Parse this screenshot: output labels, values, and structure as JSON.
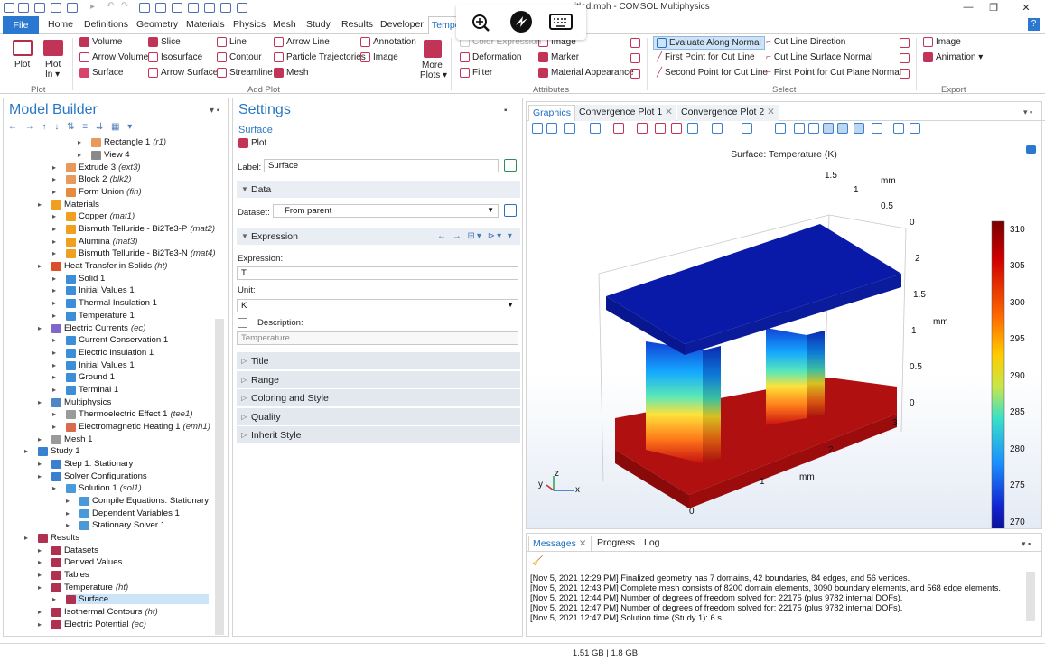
{
  "window": {
    "title": "Untitled.mph - COMSOL Multiphysics",
    "title_visible": "itled.mph - COMSOL Multiphysics",
    "help": "?"
  },
  "menu": {
    "file": "File",
    "tabs": [
      "Home",
      "Definitions",
      "Geometry",
      "Materials",
      "Physics",
      "Mesh",
      "Study",
      "Results",
      "Developer"
    ],
    "active": "Tempe"
  },
  "ribbon": {
    "plot": {
      "plot": "Plot",
      "plot_in": "Plot",
      "plot_in2": "In ▾",
      "group": "Plot"
    },
    "add_plot": {
      "col1": [
        "Volume",
        "Arrow Volume",
        "Surface"
      ],
      "col2": [
        "Slice",
        "Isosurface",
        "Arrow Surface"
      ],
      "col3": [
        "Line",
        "Contour",
        "Streamline"
      ],
      "col4": [
        "Arrow Line",
        "Particle Trajectories",
        "Mesh"
      ],
      "col5": [
        "Annotation",
        "Image"
      ],
      "more": "More",
      "more2": "Plots ▾",
      "group": "Add Plot"
    },
    "attributes": {
      "items": [
        "Color Expression",
        "Deformation",
        "Filter"
      ],
      "items2": [
        "Image",
        "Marker",
        "Material Appearance"
      ],
      "group": "Attributes"
    },
    "select": {
      "col1": [
        "Evaluate Along Normal",
        "First Point for Cut Line",
        "Second Point for Cut Line"
      ],
      "col2": [
        "Cut Line Direction",
        "Cut Line Surface Normal",
        "First Point for Cut Plane Normal"
      ],
      "group": "Select"
    },
    "export": {
      "image": "Image",
      "animation": "Animation ▾",
      "group": "Export"
    }
  },
  "model_builder": {
    "title": "Model Builder",
    "tree": [
      {
        "label": "Rectangle 1",
        "tag": "(r1)",
        "x": 97,
        "y": 158,
        "color": "#e89a5c"
      },
      {
        "label": "View 4",
        "tag": "",
        "x": 97,
        "y": 172,
        "color": "#8a8a8a"
      },
      {
        "label": "Extrude 3",
        "tag": "(ext3)",
        "x": 69,
        "y": 186,
        "color": "#e89a5c"
      },
      {
        "label": "Block 2",
        "tag": "(blk2)",
        "x": 69,
        "y": 199,
        "color": "#e89a5c"
      },
      {
        "label": "Form Union",
        "tag": "(fin)",
        "x": 69,
        "y": 213,
        "color": "#e88a3c"
      },
      {
        "label": "Materials",
        "tag": "",
        "x": 53,
        "y": 227,
        "color": "#f0a020"
      },
      {
        "label": "Copper",
        "tag": "(mat1)",
        "x": 69,
        "y": 240,
        "color": "#f0a020"
      },
      {
        "label": "Bismuth Telluride - Bi2Te3-P",
        "tag": "(mat2)",
        "x": 69,
        "y": 254,
        "color": "#f0a020"
      },
      {
        "label": "Alumina",
        "tag": "(mat3)",
        "x": 69,
        "y": 268,
        "color": "#f0a020"
      },
      {
        "label": "Bismuth Telluride - Bi2Te3-N",
        "tag": "(mat4)",
        "x": 69,
        "y": 281,
        "color": "#f0a020"
      },
      {
        "label": "Heat Transfer in Solids",
        "tag": "(ht)",
        "x": 53,
        "y": 295,
        "color": "#d9502a"
      },
      {
        "label": "Solid 1",
        "tag": "",
        "x": 69,
        "y": 309,
        "color": "#3d8ed8"
      },
      {
        "label": "Initial Values 1",
        "tag": "",
        "x": 69,
        "y": 322,
        "color": "#3d8ed8"
      },
      {
        "label": "Thermal Insulation 1",
        "tag": "",
        "x": 69,
        "y": 336,
        "color": "#3d8ed8"
      },
      {
        "label": "Temperature 1",
        "tag": "",
        "x": 69,
        "y": 350,
        "color": "#3d8ed8"
      },
      {
        "label": "Electric Currents",
        "tag": "(ec)",
        "x": 53,
        "y": 364,
        "color": "#7f66c9"
      },
      {
        "label": "Current Conservation 1",
        "tag": "",
        "x": 69,
        "y": 377,
        "color": "#3d8ed8"
      },
      {
        "label": "Electric Insulation 1",
        "tag": "",
        "x": 69,
        "y": 391,
        "color": "#3d8ed8"
      },
      {
        "label": "Initial Values 1",
        "tag": "",
        "x": 69,
        "y": 405,
        "color": "#3d8ed8"
      },
      {
        "label": "Ground 1",
        "tag": "",
        "x": 69,
        "y": 418,
        "color": "#3d8ed8"
      },
      {
        "label": "Terminal 1",
        "tag": "",
        "x": 69,
        "y": 432,
        "color": "#3d8ed8"
      },
      {
        "label": "Multiphysics",
        "tag": "",
        "x": 53,
        "y": 446,
        "color": "#4f86c6"
      },
      {
        "label": "Thermoelectric Effect 1",
        "tag": "(tee1)",
        "x": 69,
        "y": 459,
        "color": "#9a9a9a"
      },
      {
        "label": "Electromagnetic Heating 1",
        "tag": "(emh1)",
        "x": 69,
        "y": 473,
        "color": "#d96a4a"
      },
      {
        "label": "Mesh 1",
        "tag": "",
        "x": 53,
        "y": 487,
        "color": "#9a9a9a"
      },
      {
        "label": "Study 1",
        "tag": "",
        "x": 38,
        "y": 500,
        "color": "#3a7fd0"
      },
      {
        "label": "Step 1: Stationary",
        "tag": "",
        "x": 53,
        "y": 514,
        "color": "#3a7fd0"
      },
      {
        "label": "Solver Configurations",
        "tag": "",
        "x": 53,
        "y": 528,
        "color": "#3a7fd0"
      },
      {
        "label": "Solution 1",
        "tag": "(sol1)",
        "x": 69,
        "y": 541,
        "color": "#4a9ad9"
      },
      {
        "label": "Compile Equations: Stationary",
        "tag": "",
        "x": 84,
        "y": 555,
        "color": "#4a9ad9"
      },
      {
        "label": "Dependent Variables 1",
        "tag": "",
        "x": 84,
        "y": 569,
        "color": "#4a9ad9"
      },
      {
        "label": "Stationary Solver 1",
        "tag": "",
        "x": 84,
        "y": 582,
        "color": "#4a9ad9"
      },
      {
        "label": "Results",
        "tag": "",
        "x": 38,
        "y": 596,
        "color": "#b03050"
      },
      {
        "label": "Datasets",
        "tag": "",
        "x": 53,
        "y": 610,
        "color": "#b03050"
      },
      {
        "label": "Derived Values",
        "tag": "",
        "x": 53,
        "y": 623,
        "color": "#b03050"
      },
      {
        "label": "Tables",
        "tag": "",
        "x": 53,
        "y": 637,
        "color": "#b03050"
      },
      {
        "label": "Temperature",
        "tag": "(ht)",
        "x": 53,
        "y": 651,
        "color": "#b03050"
      },
      {
        "label": "Surface",
        "tag": "",
        "x": 69,
        "y": 664,
        "color": "#b03050",
        "selected": true
      },
      {
        "label": "Isothermal Contours",
        "tag": "(ht)",
        "x": 53,
        "y": 678,
        "color": "#b03050"
      },
      {
        "label": "Electric Potential",
        "tag": "(ec)",
        "x": 53,
        "y": 692,
        "color": "#b03050"
      }
    ]
  },
  "settings": {
    "title": "Settings",
    "subtitle": "Surface",
    "plot_btn": "Plot",
    "label_label": "Label:",
    "label_value": "Surface",
    "data_section": "Data",
    "dataset_label": "Dataset:",
    "dataset_value": "From parent",
    "expression_section": "Expression",
    "expression_label": "Expression:",
    "expression_value": "T",
    "unit_label": "Unit:",
    "unit_value": "K",
    "description_label": "Description:",
    "description_value": "Temperature",
    "collapsed": [
      "Title",
      "Range",
      "Coloring and Style",
      "Quality",
      "Inherit Style"
    ]
  },
  "graphics": {
    "tabs": [
      "Graphics",
      "Convergence Plot 1",
      "Convergence Plot 2"
    ],
    "plot_title": "Surface: Temperature (K)",
    "colorbar_ticks": [
      "310",
      "305",
      "300",
      "295",
      "290",
      "285",
      "280",
      "275",
      "270"
    ],
    "axis_unit": "mm",
    "x_ticks": [
      "0",
      "1",
      "2",
      "3"
    ],
    "y_ticks": [
      "0",
      "0.5",
      "1",
      "1.5"
    ],
    "z_ticks": [
      "0",
      "0.5",
      "1",
      "1.5",
      "2"
    ],
    "triad": {
      "x": "x",
      "y": "y",
      "z": "z"
    },
    "colors": {
      "hot": "#c40a0a",
      "cold": "#0b1ea8",
      "accent": "#2b78d0"
    }
  },
  "messages": {
    "tabs": [
      "Messages",
      "Progress",
      "Log"
    ],
    "lines": [
      "[Nov 5, 2021 12:29 PM] Finalized geometry has 7 domains, 42 boundaries, 84 edges, and 56 vertices.",
      "[Nov 5, 2021 12:43 PM] Complete mesh consists of 8200 domain elements, 3090 boundary elements, and 568 edge elements.",
      "[Nov 5, 2021 12:44 PM] Number of degrees of freedom solved for: 22175 (plus 9782 internal DOFs).",
      "[Nov 5, 2021 12:47 PM] Number of degrees of freedom solved for: 22175 (plus 9782 internal DOFs).",
      "[Nov 5, 2021 12:47 PM] Solution time (Study 1): 6 s."
    ]
  },
  "status": {
    "memory": "1.51 GB | 1.8 GB"
  }
}
